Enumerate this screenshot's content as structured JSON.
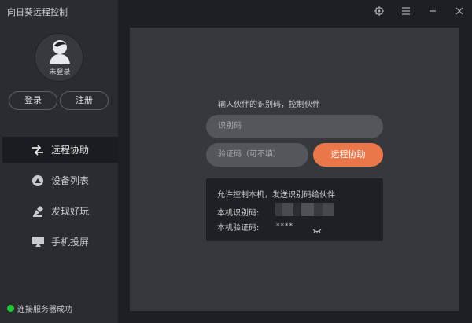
{
  "app": {
    "title": "向日葵远程控制"
  },
  "user": {
    "status": "未登录",
    "login_label": "登录",
    "register_label": "注册"
  },
  "nav": {
    "items": [
      {
        "label": "远程协助",
        "icon": "remote-assist-icon",
        "active": true
      },
      {
        "label": "设备列表",
        "icon": "device-list-icon",
        "active": false
      },
      {
        "label": "发现好玩",
        "icon": "discover-icon",
        "active": false
      },
      {
        "label": "手机投屏",
        "icon": "screen-cast-icon",
        "active": false
      }
    ]
  },
  "status": {
    "text": "连接服务器成功",
    "color": "#25c43a"
  },
  "window_controls": {
    "settings_icon": "gear-icon",
    "menu_icon": "menu-icon",
    "minimize_icon": "minimize-icon",
    "close_icon": "close-icon"
  },
  "main": {
    "prompt": "输入伙伴的识别码，控制伙伴",
    "id_placeholder": "识别码",
    "code_placeholder": "验证码（可不填）",
    "assist_button": "远程协助",
    "accent": "#e9774a",
    "info": {
      "title": "允许控制本机，发送识别码给伙伴",
      "id_label": "本机识别码:",
      "code_label": "本机验证码:",
      "code_value": "****"
    }
  }
}
